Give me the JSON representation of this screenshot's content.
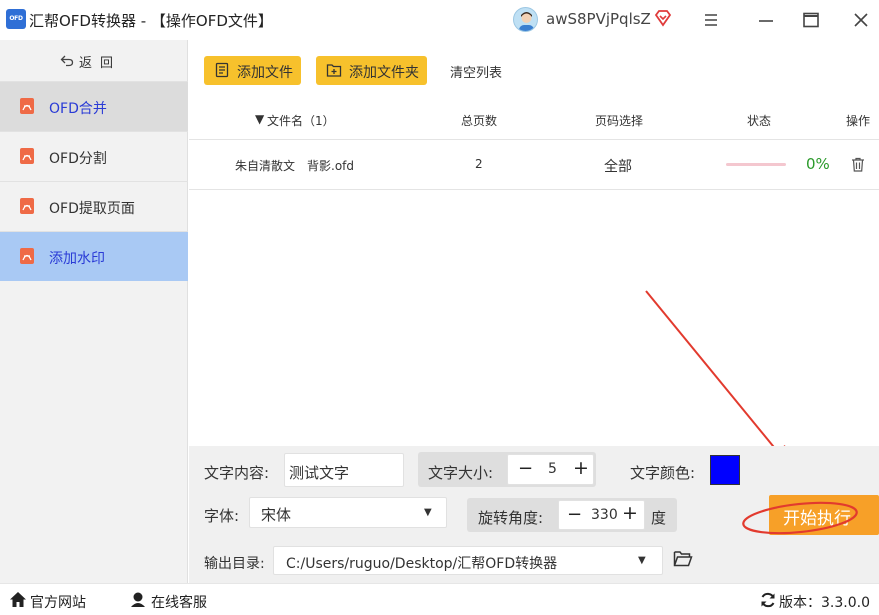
{
  "app": {
    "logo_text": "OFD",
    "title": "汇帮OFD转换器 - 【操作OFD文件】",
    "username": "awS8PVjPqlsZ",
    "accent": "#f7c12c",
    "active_nav_color": "#a9c9f4"
  },
  "sidebar": {
    "back_label": "返回",
    "items": [
      {
        "label": "OFD合并",
        "icon": "pdf-icon"
      },
      {
        "label": "OFD分割",
        "icon": "pdf-icon"
      },
      {
        "label": "OFD提取页面",
        "icon": "pdf-icon"
      },
      {
        "label": "添加水印",
        "icon": "pdf-icon"
      }
    ]
  },
  "toolbar": {
    "add_file": "添加文件",
    "add_folder": "添加文件夹",
    "clear_list": "清空列表"
  },
  "table": {
    "columns": {
      "filename": "文件名（1）",
      "pages": "总页数",
      "page_select": "页码选择",
      "status": "状态",
      "action": "操作"
    },
    "rows": [
      {
        "filename": "朱自清散文　背影.ofd",
        "pages": "2",
        "page_select": "全部",
        "progress": "0%"
      }
    ]
  },
  "settings": {
    "text_content_label": "文字内容:",
    "text_content_value": "测试文字",
    "font_size_label": "文字大小:",
    "font_size_value": "5",
    "text_color_label": "文字颜色:",
    "text_color": "#0000ff",
    "font_label": "字体:",
    "font_value": "宋体",
    "rotation_label": "旋转角度:",
    "rotation_value": "330",
    "rotation_unit": "度",
    "output_label": "输出目录:",
    "output_path": "C:/Users/ruguo/Desktop/汇帮OFD转换器",
    "start_button": "开始执行"
  },
  "statusbar": {
    "website": "官方网站",
    "support": "在线客服",
    "version": "版本：3.3.0.0"
  }
}
